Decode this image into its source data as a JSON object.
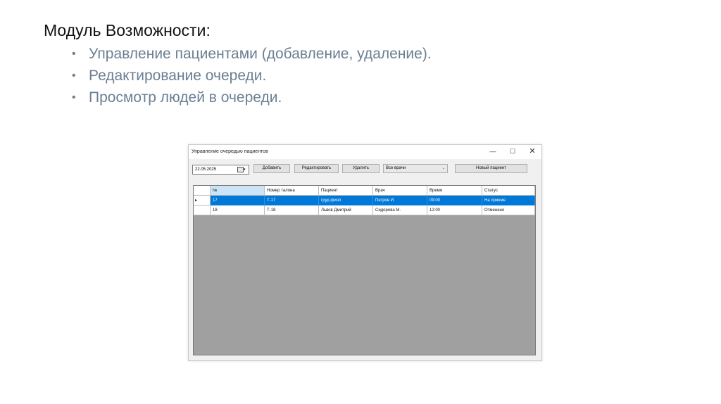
{
  "slide": {
    "heading": "Модуль Возможности:",
    "bullet_char": "•",
    "bullets": [
      "Управление пациентами (добавление, удаление).",
      "Редактирование очереди.",
      "Просмотр людей в очереди."
    ]
  },
  "window": {
    "title": "Управление очередью пациентов",
    "controls": {
      "minimize": "—",
      "maximize": "☐",
      "close": "✕"
    }
  },
  "toolbar": {
    "date": "22.05.2025",
    "date_arrow": "▾",
    "add_label": "Добавить",
    "edit_label": "Редактировать",
    "delete_label": "Удалить",
    "doctor_filter": "Все врачи",
    "doctor_arrow": "⌄",
    "new_patient_label": "Новый пациент"
  },
  "table": {
    "columns": [
      "№",
      "Номер талона",
      "Пациент",
      "Врач",
      "Время",
      "Статус"
    ],
    "current_row_marker": "▸",
    "rows": [
      [
        "17",
        "Т-17",
        "груд фиол",
        "Петров И.",
        "09:00",
        "На приеме"
      ],
      [
        "18",
        "Т-18",
        "Львов Дмитрий",
        "Сидорова М.",
        "12:00",
        "Отменено"
      ]
    ]
  },
  "colors": {
    "selection": "#0078d7",
    "bullet_text": "#6b7f93",
    "grid_background": "#a0a0a0"
  }
}
